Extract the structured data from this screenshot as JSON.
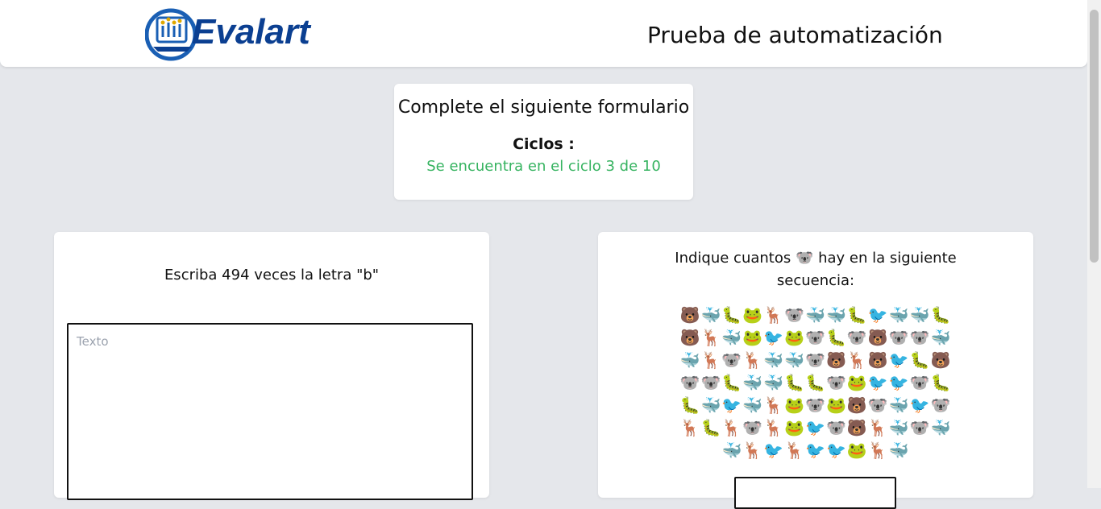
{
  "header": {
    "logo_text": "Evalart",
    "title": "Prueba de automatización"
  },
  "cycle_card": {
    "title": "Complete el siguiente formulario",
    "cycles_label": "Ciclos :",
    "status": "Se encuentra en el ciclo 3 de 10",
    "status_color": "#36b360"
  },
  "left_card": {
    "prompt": "Escriba 494 veces la letra \"b\"",
    "textarea_placeholder": "Texto",
    "textarea_value": ""
  },
  "right_card": {
    "prompt": "Indique cuantos 🐨 hay en la siguiente secuencia:",
    "emoji_rows": [
      "🐻🐳🐛🐸🦌🐨🐳🐳🐛🐦🐳🐳🐛",
      "🐻🦌🐳🐸🐦🐸🐨🐛🐨🐻🐨🐨🐳",
      "🐳🦌🐨🦌🐳🐳🐨🐻🦌🐻🐦🐛🐻",
      "🐨🐨🐛🐳🐳🐛🐛🐨🐸🐦🐦🐨🐛",
      "🐛🐳🐦🐳🦌🐸🐨🐸🐻🐨🐳🐦🐨",
      "🦌🐛🦌🐨🦌🐸🐦🐨🐻🦌🐳🐨🐳",
      "🐳🦌🐦🦌🐦🐦🐸🦌🐳"
    ],
    "answer_value": ""
  },
  "colors": {
    "background": "#e5e7eb",
    "logo_blue": "#1a5fb4",
    "logo_dark": "#0b3f91",
    "logo_gold": "#e0a800"
  }
}
